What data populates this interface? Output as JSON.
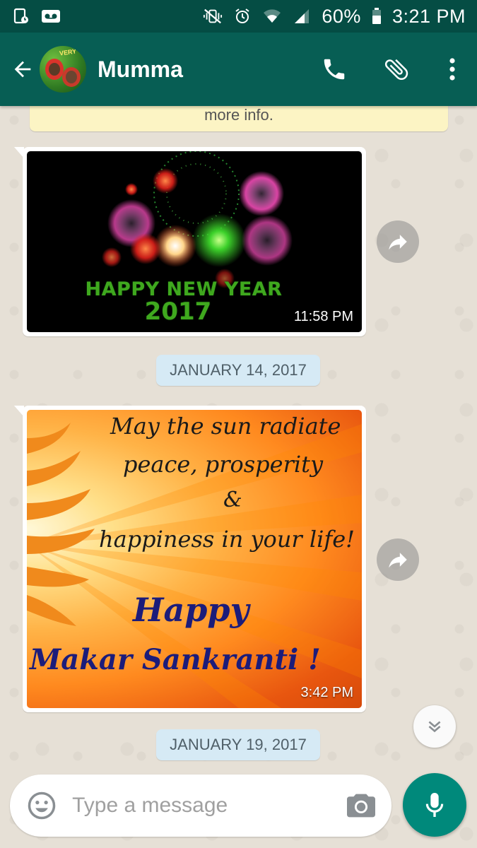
{
  "status_bar": {
    "battery": "60%",
    "time": "3:21 PM",
    "icons": [
      "sim-card-icon",
      "voicemail-icon",
      "vibrate-mute-icon",
      "alarm-icon",
      "wifi-icon",
      "signal-icon",
      "battery-icon"
    ]
  },
  "header": {
    "contact_name": "Mumma",
    "avatar_text": "VERY",
    "actions": [
      "call-icon",
      "attach-icon",
      "more-vert-icon"
    ]
  },
  "chat": {
    "info_banner_text": "more info.",
    "messages": [
      {
        "type": "image",
        "caption_line1": "HAPPY NEW YEAR",
        "caption_line2": "2017",
        "time": "11:58 PM"
      },
      {
        "type": "date",
        "label": "JANUARY 14, 2017"
      },
      {
        "type": "image",
        "line1": "May the sun radiate",
        "line2": "peace, prosperity",
        "line3": "&",
        "line4": "happiness in your life!",
        "line5": "Happy",
        "line6": "Makar Sankranti !",
        "time": "3:42 PM"
      },
      {
        "type": "date",
        "label": "JANUARY 19, 2017"
      }
    ]
  },
  "composer": {
    "placeholder": "Type a message"
  },
  "colors": {
    "header": "#075e54",
    "status_bar": "#054d44",
    "fab": "#00897b",
    "date_pill": "#d6eaf5",
    "banner": "#fcf4c4"
  }
}
